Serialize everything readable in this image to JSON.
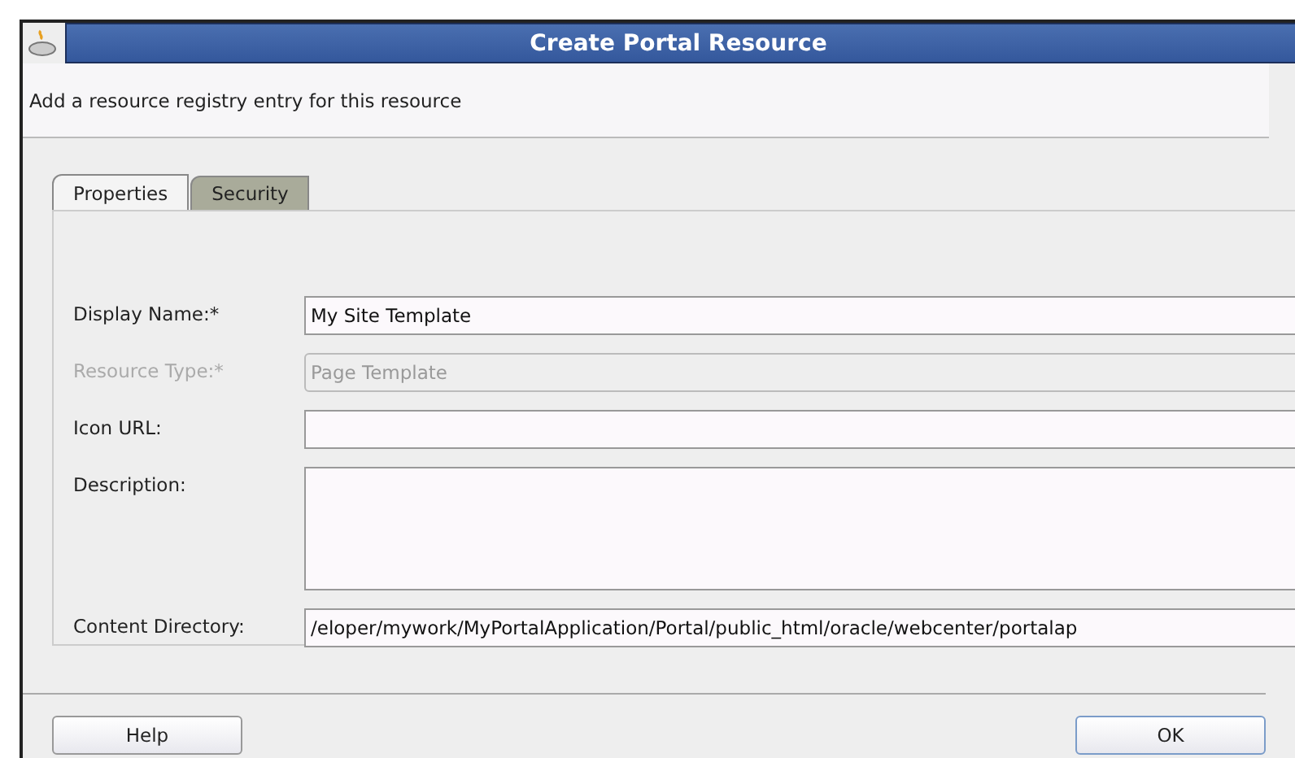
{
  "window": {
    "title": "Create Portal Resource"
  },
  "header": {
    "text": "Add a resource registry entry for this resource"
  },
  "tabs": [
    {
      "label": "Properties",
      "selected": true
    },
    {
      "label": "Security",
      "selected": false
    }
  ],
  "fields": [
    {
      "label": "Display Name:*",
      "value": "My Site Template",
      "kind": "line",
      "disabled": false
    },
    {
      "label": "Resource Type:*",
      "value": "Page Template",
      "kind": "line",
      "disabled": true
    },
    {
      "label": "Icon URL:",
      "kind": "line",
      "disabled": false
    },
    {
      "label": "Description:",
      "kind": "area",
      "disabled": false
    },
    {
      "label": "Content Directory:",
      "value": "/eloper/mywork/MyPortalApplication/Portal/public_html/oracle/webcenter/portalap",
      "kind": "line",
      "disabled": false
    }
  ],
  "buttons": [
    {
      "label": "Help",
      "kind": "help"
    },
    {
      "label": "OK",
      "kind": "ok"
    }
  ]
}
